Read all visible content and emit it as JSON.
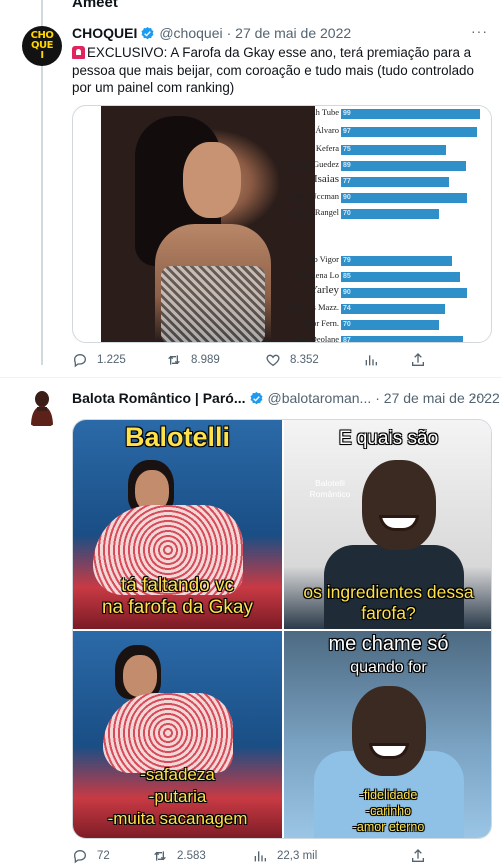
{
  "top_partial_text": "Ameet",
  "tweet1": {
    "name": "CHOQUEI",
    "handle": "@choquei",
    "date": "· 27 de mai de 2022",
    "avatar_text": [
      "CHO",
      "QUE",
      "I"
    ],
    "text": "EXCLUSIVO: A Farofa da Gkay esse ano, terá premiação para a pessoa que mais beijar, com coroação e tudo mais (tudo controlado por um painel com ranking)",
    "ranking": [
      {
        "name": "Viih Tube",
        "value": 99
      },
      {
        "name": "Álvaro",
        "value": 97
      },
      {
        "name": "Kefera",
        "value": 75
      },
      {
        "name": "Lucas Guedez",
        "value": 89
      },
      {
        "name": "Isaias",
        "value": 77
      },
      {
        "name": "Rafa Uccman",
        "value": 90
      },
      {
        "name": "Lucas Rangel",
        "value": 70
      },
      {
        "name": "Gil do Vigor",
        "value": 79
      },
      {
        "name": "Pequena Lo",
        "value": 85
      },
      {
        "name": "Yarley",
        "value": 90
      },
      {
        "name": "Matheus Mazz.",
        "value": 74
      },
      {
        "name": "Vittor Fern.",
        "value": 70
      },
      {
        "name": "Dra Deolane",
        "value": 87
      }
    ],
    "actions": {
      "replies": "1.225",
      "retweets": "8.989",
      "likes": "8.352"
    }
  },
  "tweet2": {
    "name": "Balota Romântico | Paró...",
    "handle": "@balotaroman...",
    "date": "· 27 de mai de 2022",
    "meme": {
      "p1_top": "Balotelli",
      "p1_bottom": [
        "tá faltando vc",
        "na farofa da Gkay"
      ],
      "p2_top": "E quais são",
      "p2_watermark": [
        "Balotelli",
        "Romântico"
      ],
      "p2_bottom": [
        "os ingredientes dessa",
        "farofa?"
      ],
      "p3_bottom": [
        "-safadeza",
        "-putaria",
        "-muita sacanagem"
      ],
      "p4_top": [
        "me chame só",
        "quando for"
      ],
      "p4_bottom": [
        "-fidelidade",
        "-carinho",
        "-amor eterno"
      ]
    },
    "actions": {
      "replies": "72",
      "retweets": "2.583",
      "views": "22,3 mil"
    }
  },
  "colors": {
    "verified": "#1d9bf0",
    "muted": "#536471",
    "bar": "#2f8fc9",
    "meme_text": "#ffe14a"
  }
}
